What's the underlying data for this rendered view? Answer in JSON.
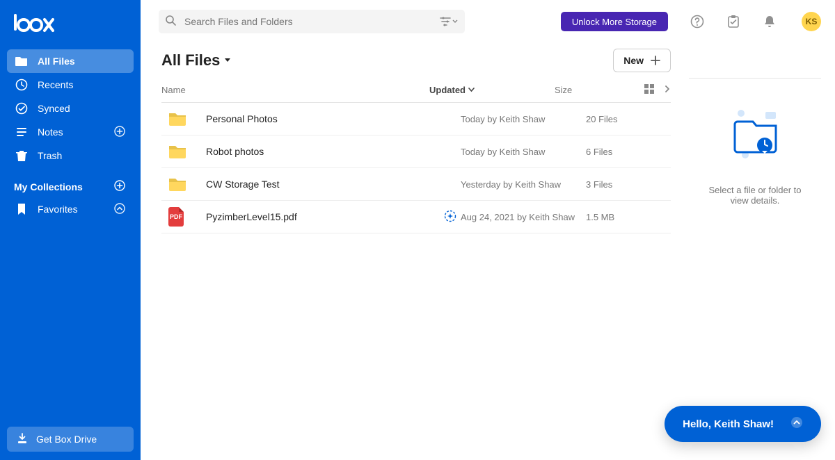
{
  "brand": "box",
  "sidebar": {
    "items": [
      {
        "label": "All Files"
      },
      {
        "label": "Recents"
      },
      {
        "label": "Synced"
      },
      {
        "label": "Notes"
      },
      {
        "label": "Trash"
      }
    ],
    "collections_header": "My Collections",
    "favorites_label": "Favorites",
    "drive_label": "Get Box Drive"
  },
  "search": {
    "placeholder": "Search Files and Folders"
  },
  "unlock_label": "Unlock More Storage",
  "avatar_initials": "KS",
  "page_title": "All Files",
  "new_label": "New",
  "columns": {
    "name": "Name",
    "updated": "Updated",
    "size": "Size"
  },
  "files": [
    {
      "name": "Personal Photos",
      "updated": "Today by Keith Shaw",
      "size": "20 Files",
      "type": "folder"
    },
    {
      "name": "Robot photos",
      "updated": "Today by Keith Shaw",
      "size": "6 Files",
      "type": "folder"
    },
    {
      "name": "CW Storage Test",
      "updated": "Yesterday by Keith Shaw",
      "size": "3 Files",
      "type": "folder"
    },
    {
      "name": "PyzimberLevel15.pdf",
      "updated": "Aug 24, 2021 by Keith Shaw",
      "size": "1.5 MB",
      "type": "pdf",
      "action": true
    }
  ],
  "pdf_badge_text": "PDF",
  "details_hint": "Select a file or folder to view details.",
  "greeting": "Hello, Keith Shaw!",
  "colors": {
    "brand_blue": "#0061d5",
    "unlock_purple": "#4826b2",
    "avatar_bg": "#ffd54f",
    "folder_yellow": "#ffd75e",
    "pdf_red": "#e33d3d"
  }
}
